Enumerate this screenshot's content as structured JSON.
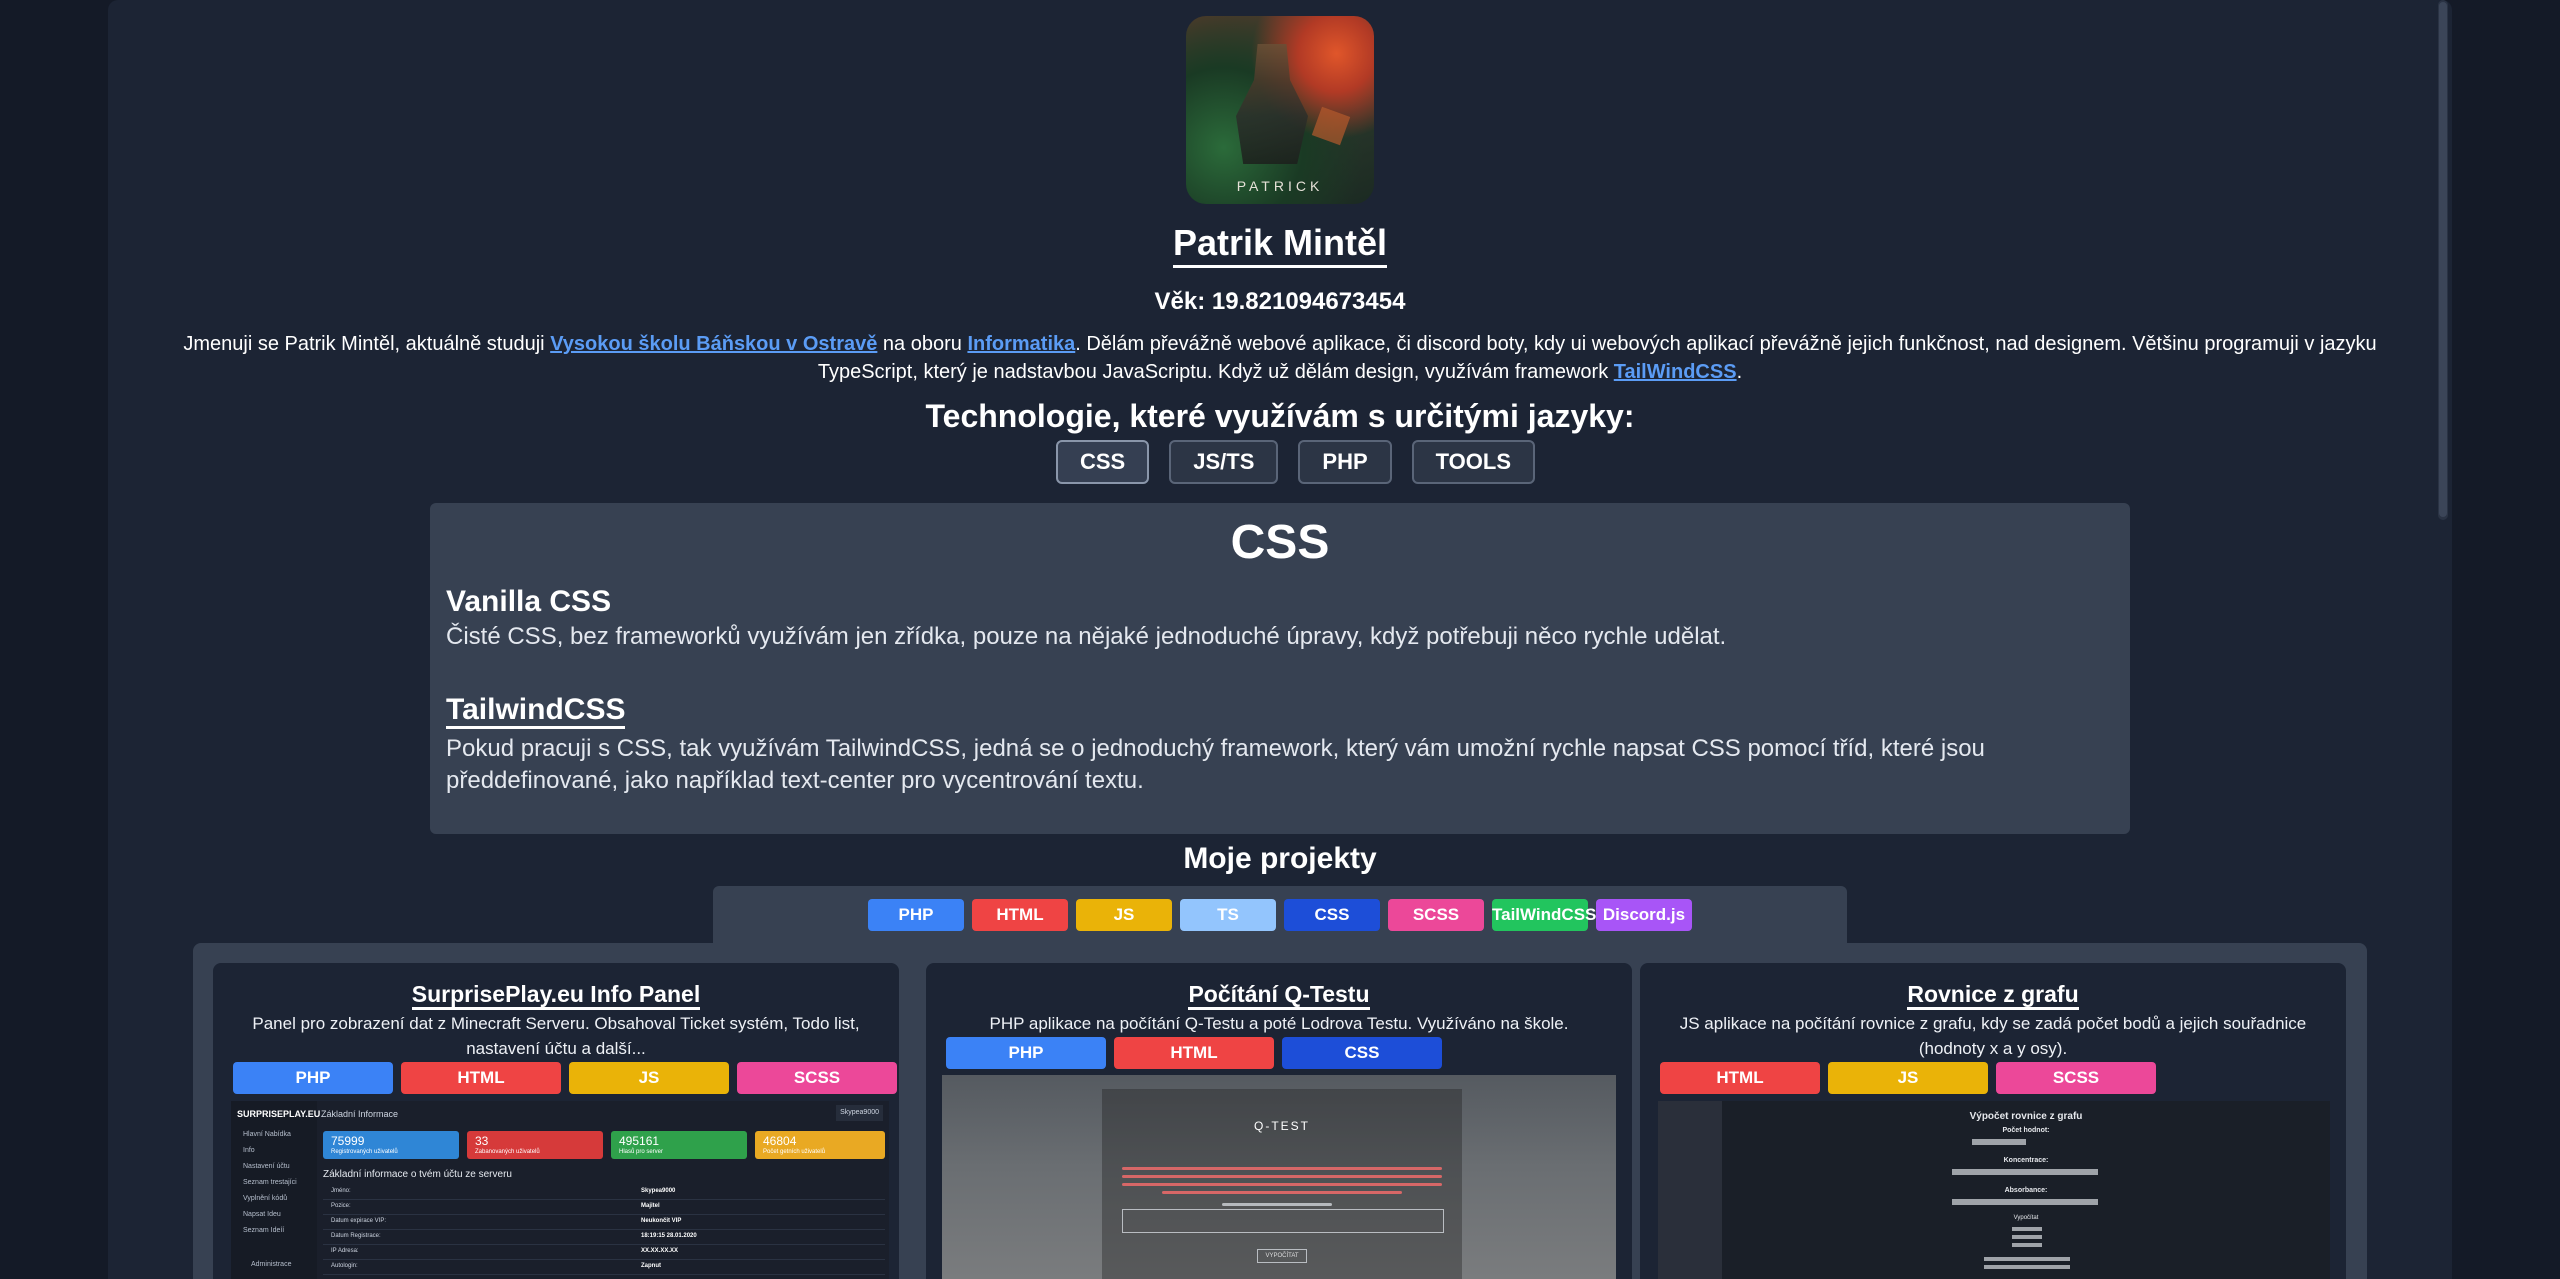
{
  "profile": {
    "avatar_text": "PATRICK",
    "name": "Patrik Mintěl",
    "age": "Věk: 19.821094673454",
    "bio_prefix": "Jmenuji se Patrik Mintěl, aktuálně studuji ",
    "bio_link_school": "Vysokou školu Báňskou v Ostravě",
    "bio_mid": " na oboru ",
    "bio_link_field": "Informatika",
    "bio_suffix": ". Dělám převážně webové aplikace, či discord boty, kdy ui webových aplikací převážně jejich funkčnost, nad designem. Většinu programuji v jazyku TypeScript, který je nadstavbou JavaScriptu. Když už dělám design, využívám framework ",
    "bio_link_tw": "TailWindCSS",
    "bio_end": "."
  },
  "technologies": {
    "heading": "Technologie, které využívám s určitými jazyky:",
    "tabs": [
      "CSS",
      "JS/TS",
      "PHP",
      "TOOLS"
    ],
    "active_tab": "CSS",
    "panel": {
      "title": "CSS",
      "items": [
        {
          "title": "Vanilla CSS",
          "text": "Čisté CSS, bez frameworků využívám jen zřídka, pouze na nějaké jednoduché úpravy, když potřebuji něco rychle udělat."
        },
        {
          "title": "TailwindCSS",
          "text": "Pokud pracuji s CSS, tak využívám TailwindCSS, jedná se o jednoduchý framework, který vám umožní rychle napsat CSS pomocí tříd, které jsou předdefinované, jako například text-center pro vycentrování textu."
        }
      ]
    }
  },
  "projects": {
    "heading": "Moje projekty",
    "filters": [
      "PHP",
      "HTML",
      "JS",
      "TS",
      "CSS",
      "SCSS",
      "TailWindCSS",
      "Discord.js"
    ],
    "cards": [
      {
        "title": "SurprisePlay.eu Info Panel",
        "description": "Panel pro zobrazení dat z Minecraft Serveru. Obsahoval Ticket systém, Todo list, nastavení účtu a další...",
        "tags": [
          "PHP",
          "HTML",
          "JS",
          "SCSS"
        ],
        "preview": {
          "brand": "SURPRISEPLAY.EU",
          "header": "Základní Informace",
          "user": "Skypea9000",
          "menu": [
            "Hlavní Nabídka",
            "Info",
            "Nastavení účtu",
            "Seznam trestajíci",
            "Vyplnění kódů",
            "Napsat Ideu",
            "Seznam Ideíí",
            "Administrace"
          ],
          "stats": [
            {
              "value": "75999",
              "label": "Registrovaných uživatelů"
            },
            {
              "value": "33",
              "label": "Zabanovaných uživatelů"
            },
            {
              "value": "495161",
              "label": "Hlasů pro server"
            },
            {
              "value": "46804",
              "label": "Počet getních uživatelů"
            }
          ],
          "section": "Základní informace o tvém účtu ze serveru",
          "rows": [
            {
              "k": "Jméno:",
              "v": "Skypea9000"
            },
            {
              "k": "Pozice:",
              "v": "Majitel"
            },
            {
              "k": "Datum expirace VIP:",
              "v": "Neukončit VIP"
            },
            {
              "k": "Datum Registrace:",
              "v": "18:19:15 28.01.2020"
            },
            {
              "k": "IP Adresa:",
              "v": "XX.XX.XX.XX"
            },
            {
              "k": "Autologin:",
              "v": "Zapnut"
            }
          ]
        }
      },
      {
        "title": "Počítání Q-Testu",
        "description": "PHP aplikace na počítání Q-Testu a poté Lodrova Testu. Využíváno na škole.",
        "tags": [
          "PHP",
          "HTML",
          "CSS"
        ],
        "preview": {
          "title": "Q-TEST",
          "button": "VYPOČÍTAT"
        }
      },
      {
        "title": "Rovnice z grafu",
        "description": "JS aplikace na počítání rovnice z grafu, kdy se zadá počet bodů a jejich souřadnice (hodnoty x a y osy).",
        "tags": [
          "HTML",
          "JS",
          "SCSS"
        ],
        "preview": {
          "title": "Výpočet rovnice z grafu",
          "labels": [
            "Počet hodnot:",
            "Koncentrace:",
            "Absorbance:"
          ],
          "button": "Vypočítat"
        }
      }
    ]
  },
  "colors": {
    "PHP": "#3b82f6",
    "HTML": "#ef4444",
    "JS": "#eab308",
    "TS": "#93c5fd",
    "CSS": "#1d4ed8",
    "SCSS": "#ec4899",
    "TailWindCSS": "#22c55e",
    "Discord.js": "#a855f7",
    "link": "#5b9cf5",
    "background": "#1c2434",
    "panel": "#374152"
  }
}
